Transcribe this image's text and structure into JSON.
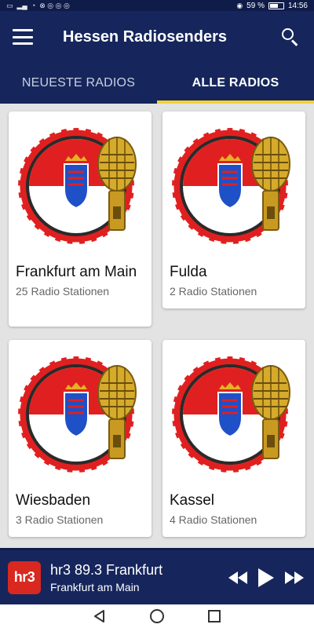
{
  "status": {
    "left_icons": [
      "sim-icon",
      "signal-icon",
      "wifi-icon",
      "notification-icons"
    ],
    "battery_text": "59 %",
    "time": "14:56"
  },
  "appbar": {
    "title": "Hessen Radiosenders"
  },
  "tabs": [
    {
      "label": "NEUESTE RADIOS",
      "active": false
    },
    {
      "label": "ALLE RADIOS",
      "active": true
    }
  ],
  "cities": [
    {
      "name": "Frankfurt am Main",
      "count": "25 Radio Stationen"
    },
    {
      "name": "Fulda",
      "count": "2 Radio Stationen"
    },
    {
      "name": "Wiesbaden",
      "count": "3 Radio Stationen"
    },
    {
      "name": "Kassel",
      "count": "4 Radio Stationen"
    }
  ],
  "player": {
    "logo_text": "hr3",
    "station": "hr3 89.3 Frankfurt",
    "city": "Frankfurt am Main"
  },
  "colors": {
    "primary": "#16265c",
    "accent": "#f2d23a",
    "logo_red": "#d9281f",
    "flag_red": "#e02020",
    "background": "#e3e3e3"
  }
}
